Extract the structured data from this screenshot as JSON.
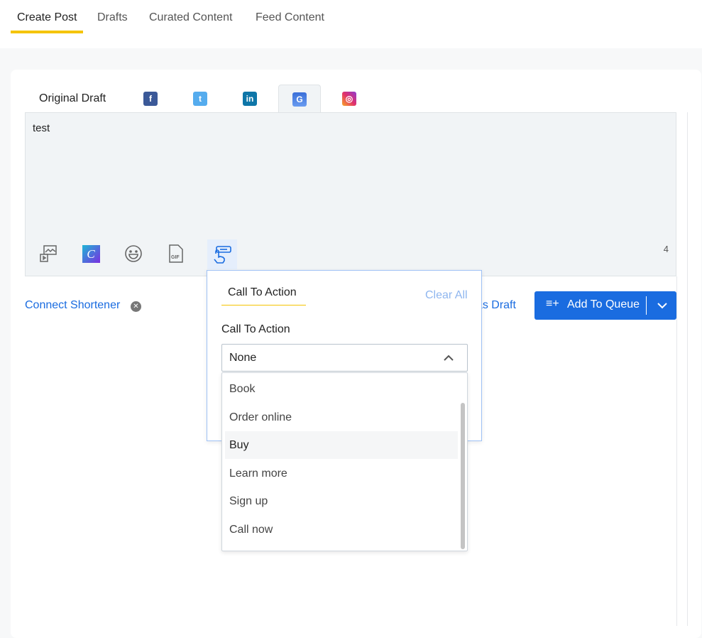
{
  "top_tabs": [
    {
      "label": "Create Post"
    },
    {
      "label": "Drafts"
    },
    {
      "label": "Curated Content"
    },
    {
      "label": "Feed Content"
    }
  ],
  "social_tabs": {
    "original": "Original Draft",
    "networks": [
      {
        "name": "facebook",
        "color": "#3b5998"
      },
      {
        "name": "twitter",
        "color": "#55acee"
      },
      {
        "name": "linkedin",
        "color": "#0e76a8"
      },
      {
        "name": "google-business",
        "color": "#4a7fe0",
        "active": true
      },
      {
        "name": "instagram",
        "color": "#e1306c"
      }
    ]
  },
  "editor": {
    "text": "test",
    "char_count": "4"
  },
  "tools": [
    "media-icon",
    "canva-icon",
    "emoji-icon",
    "gif-icon",
    "call-to-action-icon"
  ],
  "footer": {
    "connect_shortener": "Connect Shortener",
    "save_draft": "Save as Draft",
    "add_queue": "Add To Queue"
  },
  "popover": {
    "tab": "Call To Action",
    "clear_all": "Clear All",
    "field_label": "Call To Action",
    "selected": "None",
    "options": [
      "Book",
      "Order online",
      "Buy",
      "Learn more",
      "Sign up",
      "Call now"
    ],
    "highlighted": "Buy"
  },
  "colors": {
    "accent": "#1a6ce0",
    "tab_underline": "#f5c400"
  }
}
